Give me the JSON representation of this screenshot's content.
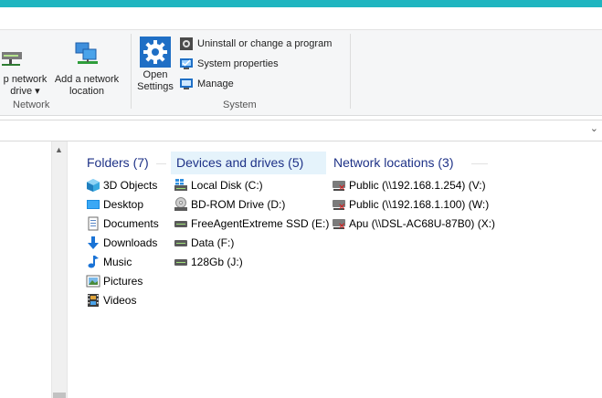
{
  "ribbon": {
    "map_network_drive_line1": "p network",
    "map_network_drive_line2": "drive ▾",
    "add_network_location_line1": "Add a network",
    "add_network_location_line2": "location",
    "network_group": "Network",
    "open_settings_line1": "Open",
    "open_settings_line2": "Settings",
    "uninstall": "Uninstall or change a program",
    "system_properties": "System properties",
    "manage": "Manage",
    "system_group": "System"
  },
  "columns": {
    "folders": "Folders (7)",
    "devices": "Devices and drives (5)",
    "network": "Network locations (3)"
  },
  "folders": [
    "3D Objects",
    "Desktop",
    "Documents",
    "Downloads",
    "Music",
    "Pictures",
    "Videos"
  ],
  "drives": [
    "Local Disk (C:)",
    "BD-ROM Drive (D:)",
    "FreeAgentExtreme SSD (E:)",
    "Data (F:)",
    "128Gb (J:)"
  ],
  "network_locations": [
    "Public (\\\\192.168.1.254) (V:)",
    "Public (\\\\192.168.1.100) (W:)",
    "Apu (\\\\DSL-AC68U-87B0) (X:)"
  ],
  "colors": {
    "accent": "#1fb5c0",
    "header_text": "#1e3287",
    "selected_header_bg": "#e5f3fb"
  }
}
